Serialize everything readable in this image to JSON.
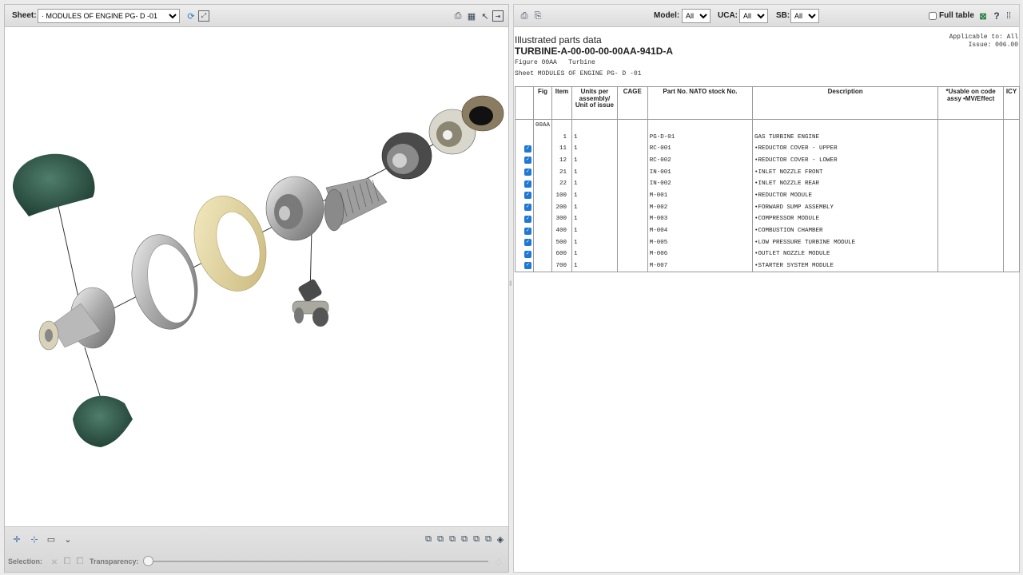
{
  "left_panel": {
    "sheet_label": "Sheet:",
    "sheet_value": "· MODULES OF ENGINE PG- D -01",
    "selection_label": "Selection:",
    "transparency_label": "Transparency:"
  },
  "right_panel": {
    "toolbar": {
      "model_label": "Model:",
      "model_value": "All",
      "uca_label": "UCA:",
      "uca_value": "All",
      "sb_label": "SB:",
      "sb_value": "All",
      "full_table_label": "Full table"
    },
    "header": {
      "section_title": "Illustrated parts data",
      "dmc": "TURBINE-A-00-00-00-00AA-941D-A",
      "figure_line": "Figure 00AA   Turbine",
      "sheet_line": "Sheet MODULES OF ENGINE PG- D -01",
      "applicable": "Applicable to: All",
      "issue": "Issue: 006.00"
    },
    "table": {
      "columns": [
        "",
        "Fig",
        "Item",
        "Units per assembly/ Unit of issue",
        "CAGE",
        "Part No. NATO stock No.",
        "Description",
        "*Usable on code assy •MV/Effect",
        "ICY"
      ],
      "fig_value": "00AA",
      "rows": [
        {
          "checked": false,
          "item": "1",
          "units": "1",
          "part": "PG-D-01",
          "desc": "GAS TURBINE ENGINE"
        },
        {
          "checked": true,
          "item": "11",
          "units": "1",
          "part": "RC-001",
          "desc": "•REDUCTOR COVER - UPPER"
        },
        {
          "checked": true,
          "item": "12",
          "units": "1",
          "part": "RC-002",
          "desc": "•REDUCTOR COVER - LOWER"
        },
        {
          "checked": true,
          "item": "21",
          "units": "1",
          "part": "IN-001",
          "desc": "•INLET NOZZLE FRONT"
        },
        {
          "checked": true,
          "item": "22",
          "units": "1",
          "part": "IN-002",
          "desc": "•INLET NOZZLE REAR"
        },
        {
          "checked": true,
          "item": "100",
          "units": "1",
          "part": "M-001",
          "desc": "•REDUCTOR MODULE"
        },
        {
          "checked": true,
          "item": "200",
          "units": "1",
          "part": "M-002",
          "desc": "•FORWARD SUMP ASSEMBLY"
        },
        {
          "checked": true,
          "item": "300",
          "units": "1",
          "part": "M-003",
          "desc": "•COMPRESSOR MODULE"
        },
        {
          "checked": true,
          "item": "400",
          "units": "1",
          "part": "M-004",
          "desc": "•COMBUSTION CHAMBER"
        },
        {
          "checked": true,
          "item": "500",
          "units": "1",
          "part": "M-005",
          "desc": "•LOW PRESSURE TURBINE MODULE"
        },
        {
          "checked": true,
          "item": "600",
          "units": "1",
          "part": "M-006",
          "desc": "•OUTLET NOZZLE MODULE"
        },
        {
          "checked": true,
          "item": "700",
          "units": "1",
          "part": "M-007",
          "desc": "•STARTER SYSTEM MODULE"
        }
      ]
    }
  },
  "colors": {
    "toolbar_bg": "#e4e4e4",
    "checkbox_blue": "#1e78d6",
    "cover_green": "#2f5a4a",
    "ring_gold": "#e6dba4"
  }
}
